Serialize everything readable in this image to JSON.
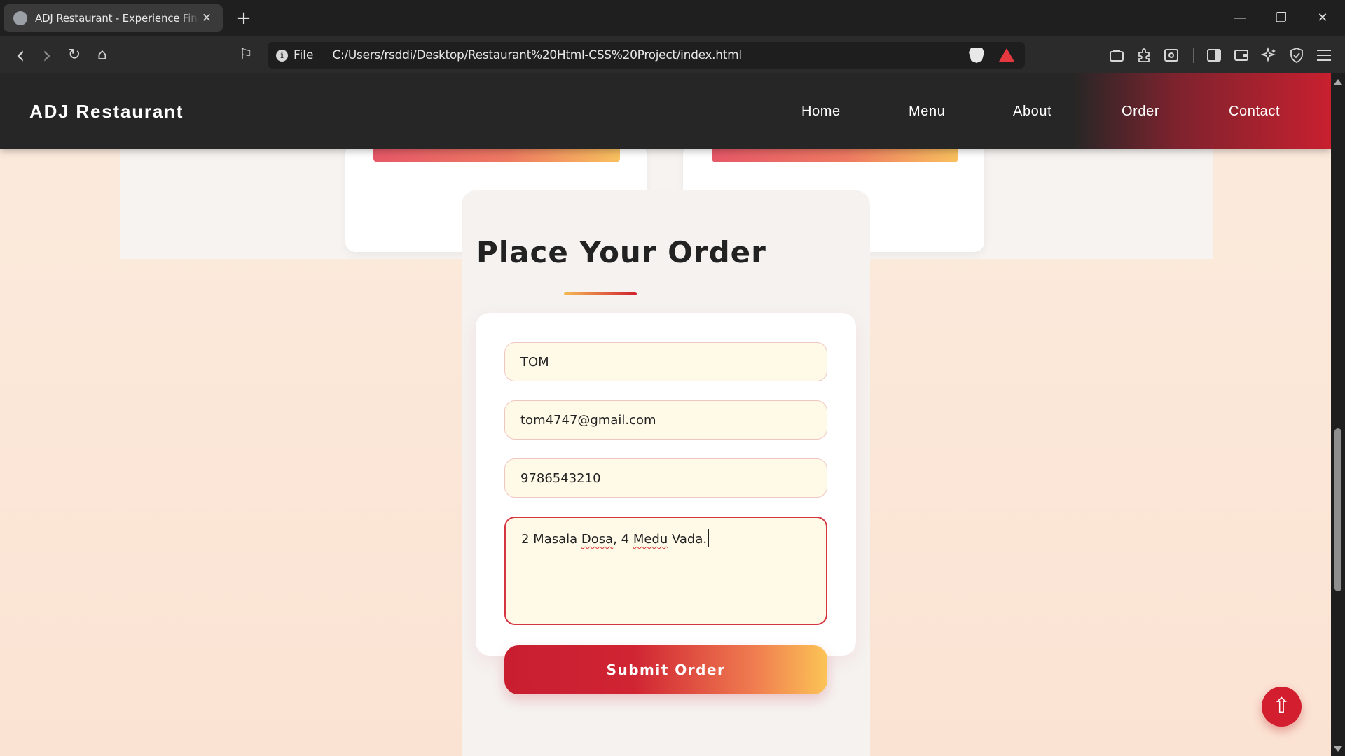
{
  "browser": {
    "tab_title": "ADJ Restaurant - Experience Fine Dining",
    "tab_close": "✕",
    "new_tab": "+",
    "window_controls": {
      "minimize": "—",
      "restore": "❐",
      "close": "✕"
    },
    "nav_icons": {
      "back": "‹",
      "forward": "›",
      "reload": "↻",
      "home": "⌂",
      "bookmark": "⚐"
    },
    "url_scheme_label": "File",
    "url": "C:/Users/rsddi/Desktop/Restaurant%20Html-CSS%20Project/index.html",
    "toolbar_icons": [
      "wallet-icon",
      "extensions-icon",
      "reader-icon",
      "sidebar-icon",
      "wallet-card-icon",
      "leo-ai-icon",
      "vpn-icon",
      "menu-icon"
    ]
  },
  "site": {
    "brand": "ADJ Restaurant",
    "nav": [
      "Home",
      "Menu",
      "About",
      "Order",
      "Contact"
    ]
  },
  "order": {
    "heading": "Place Your Order",
    "name_value": "TOM",
    "email_value": "tom4747@gmail.com",
    "phone_value": "9786543210",
    "items_value_parts": [
      "2 Masala ",
      "Dosa",
      ", 4 ",
      "Medu",
      " Vada."
    ],
    "submit_label": "Submit Order"
  },
  "scroll_top_glyph": "⇧",
  "colors": {
    "accent_red": "#c81e30",
    "accent_yellow": "#fcc456",
    "nav_bg": "#262626",
    "page_bg": "#fbebdd"
  }
}
